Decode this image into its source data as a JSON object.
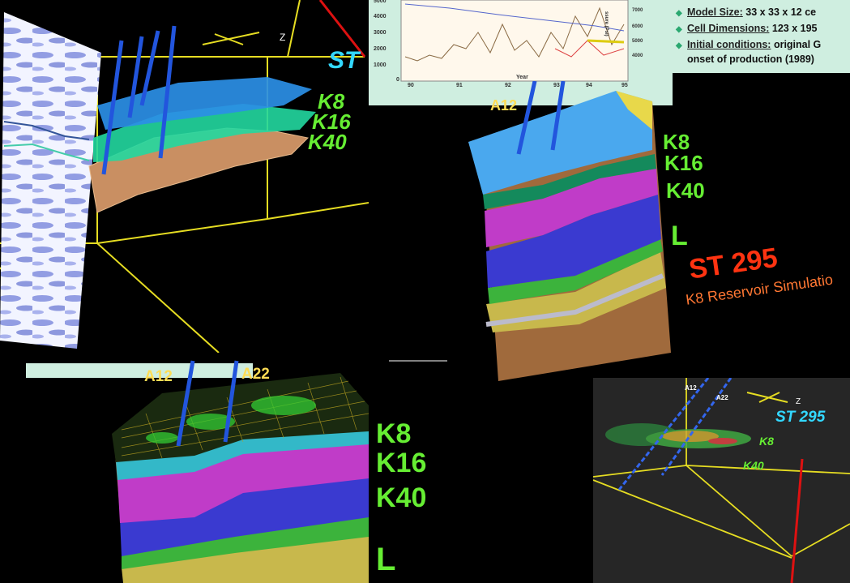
{
  "colors": {
    "horizon_k8": "#2b8fe6",
    "horizon_k16": "#22d8a0",
    "horizon_k40": "#c98f62",
    "layer_purple": "#c03cc8",
    "layer_blue": "#3a3ad0",
    "layer_green": "#3cb33c",
    "layer_olive": "#c8b84c",
    "layer_brown": "#a06a3c",
    "label_green": "#66ee33",
    "label_cyan": "#33d8ff",
    "label_yellow": "#ffdd55",
    "title_red": "#ff3311",
    "frame_yellow": "#e6dd22"
  },
  "top_left": {
    "title_partial": "ST",
    "horizons": [
      "K8",
      "K16",
      "K40"
    ]
  },
  "chart_inset": {
    "x_label_partial": "Year",
    "x_ticks": [
      "90",
      "91",
      "92",
      "93",
      "94",
      "95"
    ],
    "y_ticks": [
      "0",
      "1000",
      "2000",
      "3000",
      "4000",
      "5000"
    ],
    "y2_label_partial": "ssure (Psi)",
    "y2_ticks": [
      "7000",
      "6000",
      "5000",
      "4000"
    ]
  },
  "info_box": {
    "rows": [
      {
        "key": "Model Size:",
        "value": " 33 x 33 x 12 ce"
      },
      {
        "key": "Cell Dimensions:",
        "value": " 123 x 195"
      },
      {
        "key": "Initial conditions:",
        "value": " original G"
      },
      {
        "key": "",
        "value": "onset of production (1989)"
      }
    ]
  },
  "center_block": {
    "well": "A12",
    "horizons": [
      "K8",
      "K16",
      "K40",
      "L"
    ],
    "title": "ST 295",
    "subtitle": "K8 Reservoir Simulatio"
  },
  "bottom_left": {
    "wells": [
      "A12",
      "A22"
    ],
    "horizons": [
      "K8",
      "K16",
      "K40",
      "L"
    ]
  },
  "bottom_right": {
    "wells": [
      "A12",
      "A22"
    ],
    "title": "ST 295",
    "horizons": [
      "K8",
      "K40"
    ]
  }
}
